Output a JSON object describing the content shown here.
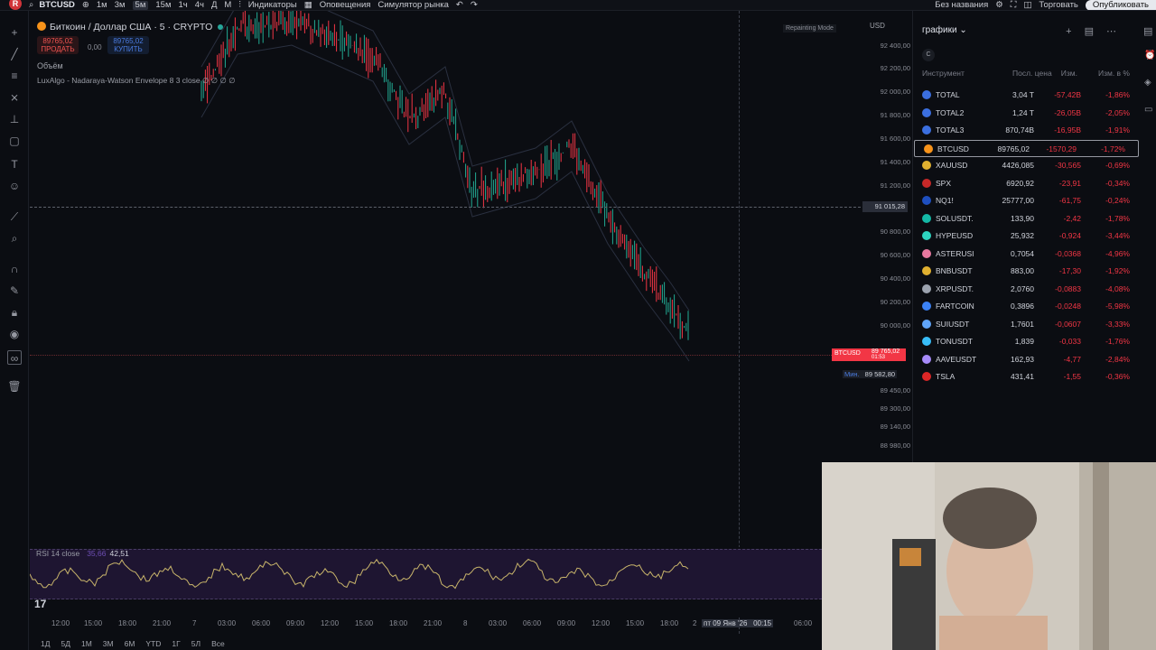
{
  "topbar": {
    "symbol": "BTCUSD",
    "intervals": [
      "1м",
      "3м",
      "5м",
      "15м",
      "1ч",
      "4ч",
      "Д",
      "М"
    ],
    "active_interval": "5м",
    "indicators": "Индикаторы",
    "alerts": "Оповещения",
    "simulator": "Симулятор рынка",
    "layout_name": "Без названия",
    "layout_sub": "Сохранить",
    "trade": "Торговать",
    "publish": "Опубликовать"
  },
  "chart": {
    "title": "Биткоин / Доллар США · 5 · CRYPTO",
    "sell_price": "89765,02",
    "sell_label": "ПРОДАТЬ",
    "spread": "0,00",
    "buy_price": "89765,02",
    "buy_label": "КУПИТЬ",
    "volume_label": "Объём",
    "indicator_label": "LuxAlgo - Nadaraya-Watson Envelope 8 3 close ∅ ∅ ∅ ∅",
    "replay_mode": "Repainting Mode",
    "currency": "USD",
    "crosshair_price": "91 015,28",
    "btc_tag_symbol": "BTCUSD",
    "btc_tag_price": "89 765,02",
    "btc_tag_time": "01:53",
    "min_label": "Мин.",
    "min_price": "89 582,80",
    "price_levels": [
      "92 400,00",
      "92 200,00",
      "92 000,00",
      "91 800,00",
      "91 600,00",
      "91 400,00",
      "91 200,00",
      "90 800,00",
      "90 600,00",
      "90 400,00",
      "90 200,00",
      "90 000,00",
      "89 450,00",
      "89 300,00",
      "89 140,00",
      "88 980,00"
    ]
  },
  "rsi": {
    "label": "RSI 14 close",
    "value1": "35,66",
    "value2": "42,51"
  },
  "time_axis": {
    "labels": [
      "12:00",
      "15:00",
      "18:00",
      "21:00",
      "7",
      "03:00",
      "06:00",
      "09:00",
      "12:00",
      "15:00",
      "18:00",
      "21:00",
      "8",
      "03:00",
      "06:00",
      "09:00",
      "12:00",
      "15:00",
      "18:00",
      "2"
    ],
    "highlight_date": "пт 09 Янв '26",
    "highlight_time": "00:15",
    "last_label": "06:00"
  },
  "bottom_bar": {
    "ranges": [
      "1Д",
      "5Д",
      "1М",
      "3М",
      "6М",
      "YTD",
      "1Г",
      "5Л",
      "Все"
    ]
  },
  "watchlist": {
    "title": "графики",
    "c_badge": "C",
    "columns": {
      "instrument": "Инструмент",
      "last": "Посл. цена",
      "change": "Изм.",
      "change_pct": "Изм. в %"
    },
    "rows": [
      {
        "name": "TOTAL",
        "last": "3,04 T",
        "change": "-57,42B",
        "pct": "-1,86%",
        "icon_color": "#3b6fe0"
      },
      {
        "name": "TOTAL2",
        "last": "1,24 T",
        "change": "-26,05B",
        "pct": "-2,05%",
        "icon_color": "#3b6fe0"
      },
      {
        "name": "TOTAL3",
        "last": "870,74B",
        "change": "-16,95B",
        "pct": "-1,91%",
        "icon_color": "#3b6fe0"
      },
      {
        "name": "BTCUSD",
        "last": "89765,02",
        "change": "-1570,29",
        "pct": "-1,72%",
        "icon_color": "#f7931a"
      },
      {
        "name": "XAUUSD",
        "last": "4426,085",
        "change": "-30,565",
        "pct": "-0,69%",
        "icon_color": "#e0b030"
      },
      {
        "name": "SPX",
        "last": "6920,92",
        "change": "-23,91",
        "pct": "-0,34%",
        "icon_color": "#c62828"
      },
      {
        "name": "NQ1!",
        "last": "25777,00",
        "change": "-61,75",
        "pct": "-0,24%",
        "icon_color": "#1e4fbf"
      },
      {
        "name": "SOLUSDT.",
        "last": "133,90",
        "change": "-2,42",
        "pct": "-1,78%",
        "icon_color": "#14b8a6"
      },
      {
        "name": "HYPEUSD",
        "last": "25,932",
        "change": "-0,924",
        "pct": "-3,44%",
        "icon_color": "#2dd4bf"
      },
      {
        "name": "ASTERUSI",
        "last": "0,7054",
        "change": "-0,0368",
        "pct": "-4,96%",
        "icon_color": "#e879a0"
      },
      {
        "name": "BNBUSDT",
        "last": "883,00",
        "change": "-17,30",
        "pct": "-1,92%",
        "icon_color": "#e0b030"
      },
      {
        "name": "XRPUSDT.",
        "last": "2,0760",
        "change": "-0,0883",
        "pct": "-4,08%",
        "icon_color": "#9ca3af"
      },
      {
        "name": "FARTCOIN",
        "last": "0,3896",
        "change": "-0,0248",
        "pct": "-5,98%",
        "icon_color": "#3b82f6"
      },
      {
        "name": "SUIUSDT",
        "last": "1,7601",
        "change": "-0,0607",
        "pct": "-3,33%",
        "icon_color": "#60a5fa"
      },
      {
        "name": "TONUSDT",
        "last": "1,839",
        "change": "-0,033",
        "pct": "-1,76%",
        "icon_color": "#38bdf8"
      },
      {
        "name": "AAVEUSDT",
        "last": "162,93",
        "change": "-4,77",
        "pct": "-2,84%",
        "icon_color": "#a78bfa"
      },
      {
        "name": "TSLA",
        "last": "431,41",
        "change": "-1,55",
        "pct": "-0,36%",
        "icon_color": "#dc2626"
      }
    ]
  }
}
